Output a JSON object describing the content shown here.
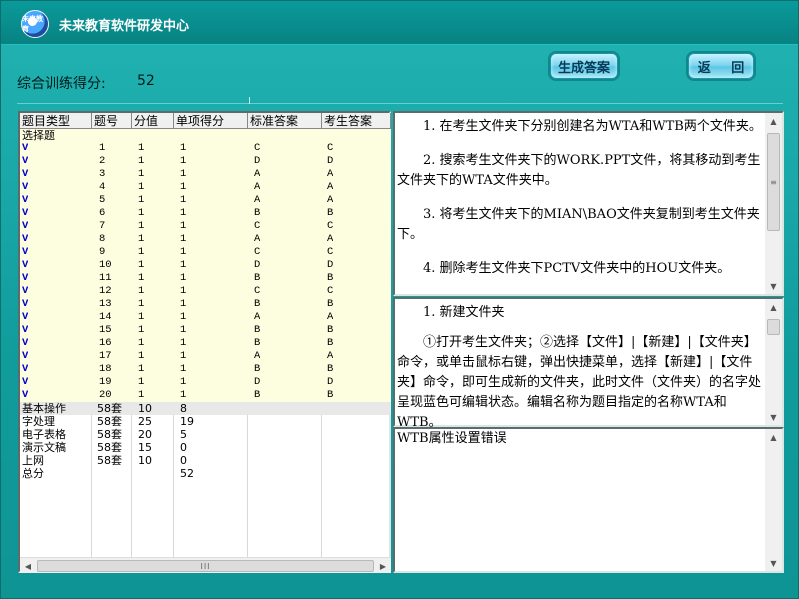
{
  "app": {
    "title": "未来教育软件研发中心",
    "logo_text": "未来教育"
  },
  "score": {
    "label": "综合训练得分:",
    "value": "52"
  },
  "buttons": {
    "generate": "生成答案",
    "back": "返 回"
  },
  "table": {
    "headers": [
      "题目类型",
      "题号",
      "分值",
      "单项得分",
      "标准答案",
      "考生答案"
    ],
    "section_title": "选择题",
    "mc_rows": [
      [
        "V",
        "1",
        "1",
        "1",
        "C",
        "C"
      ],
      [
        "V",
        "2",
        "1",
        "1",
        "D",
        "D"
      ],
      [
        "V",
        "3",
        "1",
        "1",
        "A",
        "A"
      ],
      [
        "V",
        "4",
        "1",
        "1",
        "A",
        "A"
      ],
      [
        "V",
        "5",
        "1",
        "1",
        "A",
        "A"
      ],
      [
        "V",
        "6",
        "1",
        "1",
        "B",
        "B"
      ],
      [
        "V",
        "7",
        "1",
        "1",
        "C",
        "C"
      ],
      [
        "V",
        "8",
        "1",
        "1",
        "A",
        "A"
      ],
      [
        "V",
        "9",
        "1",
        "1",
        "C",
        "C"
      ],
      [
        "V",
        "10",
        "1",
        "1",
        "D",
        "D"
      ],
      [
        "V",
        "11",
        "1",
        "1",
        "B",
        "B"
      ],
      [
        "V",
        "12",
        "1",
        "1",
        "C",
        "C"
      ],
      [
        "V",
        "13",
        "1",
        "1",
        "B",
        "B"
      ],
      [
        "V",
        "14",
        "1",
        "1",
        "A",
        "A"
      ],
      [
        "V",
        "15",
        "1",
        "1",
        "B",
        "B"
      ],
      [
        "V",
        "16",
        "1",
        "1",
        "B",
        "B"
      ],
      [
        "V",
        "17",
        "1",
        "1",
        "A",
        "A"
      ],
      [
        "V",
        "18",
        "1",
        "1",
        "B",
        "B"
      ],
      [
        "V",
        "19",
        "1",
        "1",
        "D",
        "D"
      ],
      [
        "V",
        "20",
        "1",
        "1",
        "B",
        "B"
      ]
    ],
    "summary_rows": [
      [
        "基本操作",
        "58套",
        "10",
        "8"
      ],
      [
        "字处理",
        "58套",
        "25",
        "19"
      ],
      [
        "电子表格",
        "58套",
        "20",
        "5"
      ],
      [
        "演示文稿",
        "58套",
        "15",
        "0"
      ],
      [
        "上网",
        "58套",
        "10",
        "0"
      ],
      [
        "总分",
        "",
        "",
        "52"
      ]
    ]
  },
  "question_text": [
    "1. 在考生文件夹下分别创建名为WTA和WTB两个文件夹。",
    "2. 搜索考生文件夹下的WORK.PPT文件，将其移动到考生文件夹下的WTA文件夹中。",
    "3. 将考生文件夹下的MIAN\\BAO文件夹复制到考生文件夹下。",
    "4. 删除考生文件夹下PCTV文件夹中的HOU文件夹。"
  ],
  "answer_text": [
    "1. 新建文件夹",
    "①打开考生文件夹；②选择【文件】|【新建】|【文件夹】命令，或单击鼠标右键，弹出快捷菜单，选择【新建】|【文件夹】命令，即可生成新的文件夹，此时文件（文件夹）的名字处呈现蓝色可编辑状态。编辑名称为题目指定的名称WTA和WTB。"
  ],
  "error_text": "WTB属性设置错误",
  "scroll": {
    "h_thumb": "III",
    "v_thumb": "≡"
  }
}
